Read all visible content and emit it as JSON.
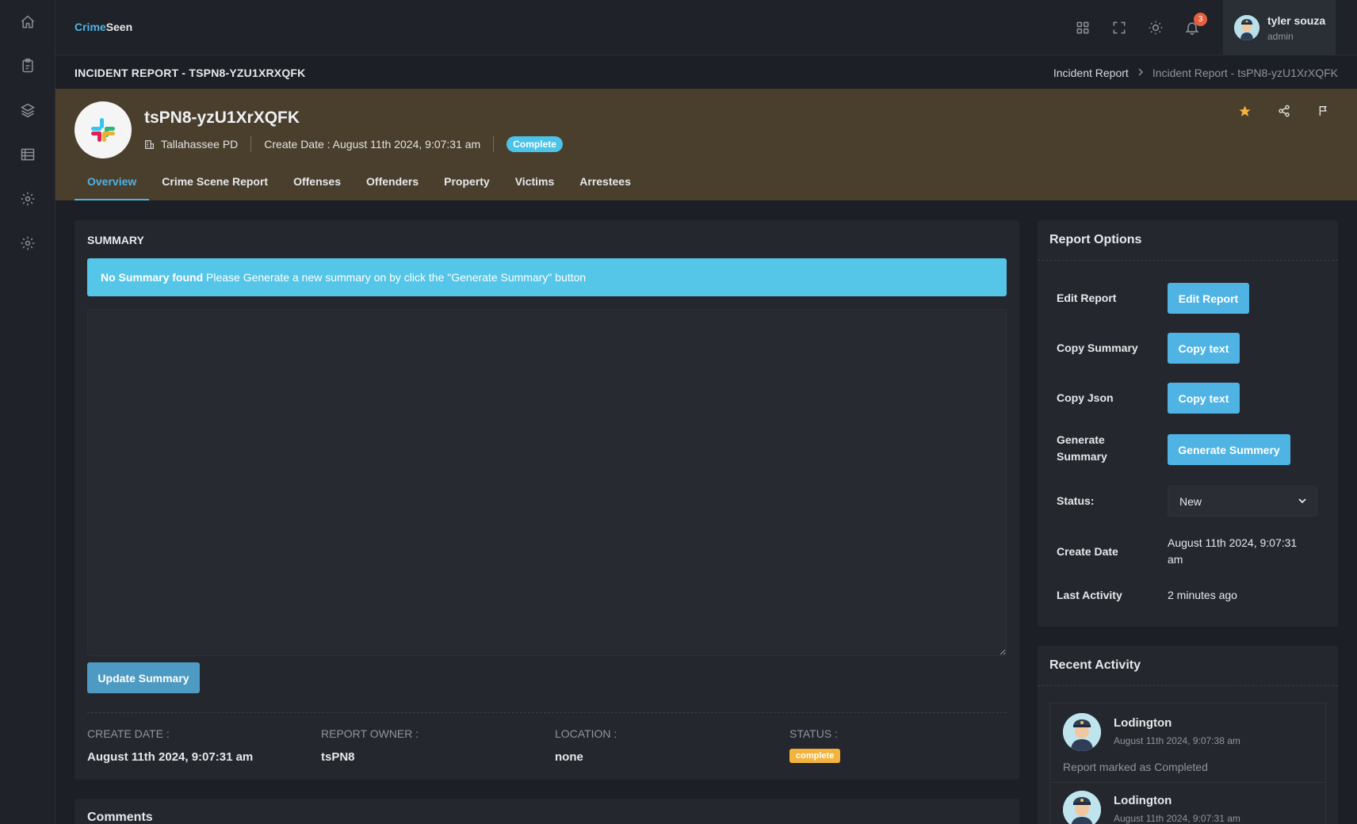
{
  "sidebar": {
    "items": [
      {
        "icon": "home-icon"
      },
      {
        "icon": "clipboard-icon"
      },
      {
        "icon": "layers-icon"
      },
      {
        "icon": "list-icon"
      },
      {
        "icon": "gear-icon"
      },
      {
        "icon": "gear-icon"
      }
    ]
  },
  "header": {
    "brand_part1": "Crime",
    "brand_part2": "Seen",
    "notification_count": "3",
    "user_name": "tyler souza",
    "user_role": "admin"
  },
  "titlebar": {
    "title": "INCIDENT REPORT - TSPN8-YZU1XRXQFK",
    "breadcrumb_parent": "Incident Report",
    "breadcrumb_current": "Incident Report - tsPN8-yzU1XrXQFK"
  },
  "hero": {
    "report_id": "tsPN8-yzU1XrXQFK",
    "agency": "Tallahassee PD",
    "create_date": "Create Date : August 11th 2024, 9:07:31 am",
    "status_badge": "Complete"
  },
  "tabs": [
    "Overview",
    "Crime Scene Report",
    "Offenses",
    "Offenders",
    "Property",
    "Victims",
    "Arrestees"
  ],
  "summary": {
    "heading": "SUMMARY",
    "alert_bold": "No Summary found",
    "alert_text": " Please Generate a new summary on by click the \"Generate Summary\" button",
    "text_value": "",
    "update_button": "Update Summary",
    "stats": [
      {
        "label": "CREATE DATE :",
        "value": "August 11th 2024, 9:07:31 am"
      },
      {
        "label": "REPORT OWNER :",
        "value": "tsPN8"
      },
      {
        "label": "LOCATION :",
        "value": "none"
      },
      {
        "label": "STATUS :",
        "value": "complete"
      }
    ]
  },
  "comments": {
    "heading": "Comments"
  },
  "report_options": {
    "heading": "Report Options",
    "edit_label": "Edit Report",
    "edit_button": "Edit Report",
    "copy_summary_label": "Copy Summary",
    "copy_summary_button": "Copy text",
    "copy_json_label": "Copy Json",
    "copy_json_button": "Copy text",
    "generate_label_line1": "Generate",
    "generate_label_line2": "Summary",
    "generate_button": "Generate Summery",
    "status_label": "Status:",
    "status_value": "New",
    "create_date_label": "Create Date",
    "create_date_line1": "August 11th 2024, 9:07:31",
    "create_date_line2": "am",
    "last_activity_label": "Last Activity",
    "last_activity_value": "2 minutes ago"
  },
  "recent_activity": {
    "heading": "Recent Activity",
    "items": [
      {
        "name": "Lodington",
        "time": "August 11th 2024, 9:07:38 am",
        "text": "Report marked as Completed"
      },
      {
        "name": "Lodington",
        "time": "August 11th 2024, 9:07:31 am"
      }
    ]
  },
  "colors": {
    "accent": "#4fb3e4",
    "hero_bg": "#4a3f2d",
    "badge_complete": "#4cc3e8",
    "badge_status": "#f4b43c",
    "notification": "#e85e3e",
    "star": "#f4b43c"
  }
}
